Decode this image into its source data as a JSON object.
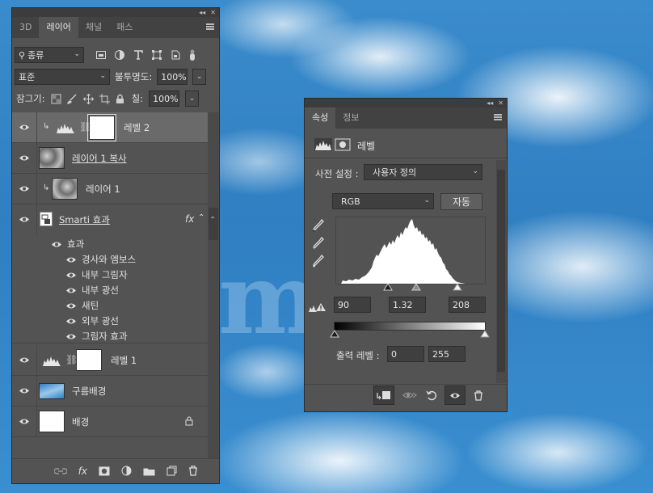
{
  "layers_panel": {
    "tabs": [
      "3D",
      "레이어",
      "채널",
      "패스"
    ],
    "active_tab": "레이어",
    "filter": {
      "label": "종류"
    },
    "blend_mode": "표준",
    "opacity_label": "불투명도:",
    "opacity_value": "100%",
    "lock_label": "잠그기:",
    "fill_label": "칠:",
    "fill_value": "100%",
    "layers": [
      {
        "name": "레벨 2",
        "kind": "adjustment-levels",
        "selected": true,
        "clipped": true
      },
      {
        "name": "레이어 1 복사",
        "kind": "pixel",
        "selected": false,
        "clipped": false
      },
      {
        "name": "레이어 1",
        "kind": "pixel",
        "selected": false,
        "clipped": true
      },
      {
        "name": "Smarti 효과",
        "kind": "smart-object",
        "selected": false,
        "clipped": false,
        "fx_badge": "fx"
      },
      {
        "name": "레벨 1",
        "kind": "adjustment-levels",
        "selected": false,
        "clipped": false
      },
      {
        "name": "구름배경",
        "kind": "image",
        "selected": false,
        "clipped": false
      },
      {
        "name": "배경",
        "kind": "background",
        "selected": false,
        "locked": true
      }
    ],
    "effects_header": "효과",
    "effects": [
      "경사와 엠보스",
      "내부 그림자",
      "내부 광선",
      "새틴",
      "외부 광선",
      "그림자 효과"
    ],
    "fx_button_label": "fx"
  },
  "properties_panel": {
    "tabs": [
      "속성",
      "정보"
    ],
    "active_tab": "속성",
    "title": "레벨",
    "preset_label": "사전 설정 :",
    "preset_value": "사용자 정의",
    "channel_value": "RGB",
    "auto_button": "자동",
    "input_black": "90",
    "input_gamma": "1.32",
    "input_white": "208",
    "output_label": "출력 레벨 :",
    "output_black": "0",
    "output_white": "255"
  },
  "colors": {
    "panel": "#535353",
    "panel_dark": "#424242",
    "selected_row": "#6a6a6a",
    "text": "#e2e2e2"
  }
}
